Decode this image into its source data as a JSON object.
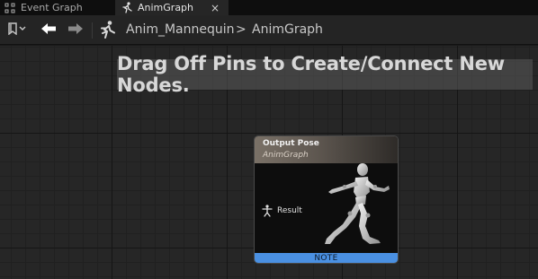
{
  "tabs": [
    {
      "label": "Event Graph",
      "icon": "event-graph-icon"
    },
    {
      "label": "AnimGraph",
      "icon": "running-man-icon",
      "close": "×"
    }
  ],
  "toolbar": {
    "bookmark_icon": "bookmark-icon",
    "back_icon": "back-arrow-icon",
    "forward_icon": "forward-arrow-icon"
  },
  "breadcrumb": {
    "items": [
      "Anim_Mannequin",
      "AnimGraph"
    ],
    "separator": ">"
  },
  "canvas": {
    "hint": "Drag Off Pins to Create/Connect New Nodes."
  },
  "node": {
    "title": "Output Pose",
    "subtitle": "AnimGraph",
    "pin_label": "Result",
    "note": "NOTE",
    "note_color": "#4a90e2"
  }
}
